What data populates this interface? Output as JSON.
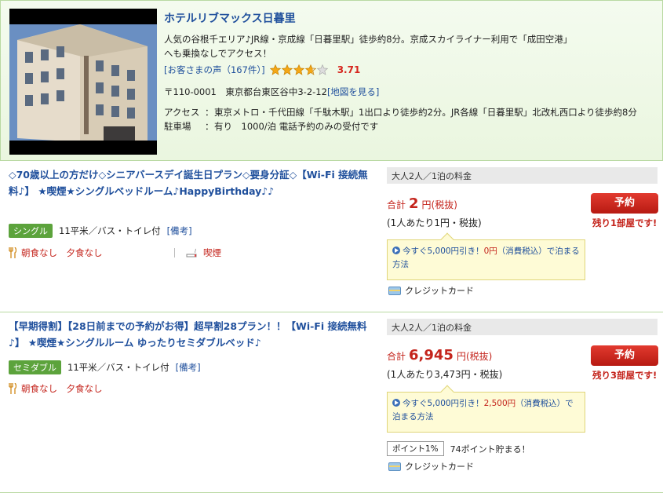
{
  "hotel": {
    "name": "ホテルリブマックス日暮里",
    "description": "人気の谷根千エリア♪JR線・京成線「日暮里駅」徒歩約8分。京成スカイライナー利用で「成田空港」へも乗換なしでアクセス！",
    "review_link": "[お客さまの声（167件）]",
    "rating_stars": 3.71,
    "rating_score": "3.71",
    "address": "〒110-0001　東京都台東区谷中3-2-12",
    "map_link": "[地図を見る]",
    "access_label": "アクセス",
    "access_text": "東京メトロ・千代田線「千駄木駅」1出口より徒歩約2分。JR各線「日暮里駅」北改札西口より徒歩約8分",
    "parking_label": "駐車場",
    "parking_text": "有り　1000/泊 電話予約のみの受付です",
    "separator": "："
  },
  "plans": [
    {
      "title": "◇70歳以上の方だけ◇シニアバースデイ誕生日プラン◇要身分証◇【Wi-Fi 接続無料♪】 ★喫煙★シングルベッドルーム♪HappyBirthday♪♪",
      "room_type": "シングル",
      "room_info": "11平米／バス・トイレ付",
      "notes_link": "[備考]",
      "meals": "朝食なし　夕食なし",
      "smoking": "喫煙",
      "price_header": "大人2人／1泊の料金",
      "total_label": "合計",
      "total_amount": "2",
      "total_unit": "円(税抜)",
      "per_person": "(1人あたり1円・税抜)",
      "reserve_label": "予約",
      "rooms_left": "残り1部屋です!",
      "promo_prefix": "今すぐ5,000円引き！",
      "promo_amount": "0円",
      "promo_suffix": "（消費税込）で泊まる方法",
      "payment": "クレジットカード"
    },
    {
      "title": "【早期得割】【28日前までの予約がお得】超早割28プラン！！【Wi-Fi 接続無料♪】 ★喫煙★シングルルーム ゆったりセミダブルベッド♪",
      "room_type": "セミダブル",
      "room_info": "11平米／バス・トイレ付",
      "notes_link": "[備考]",
      "meals": "朝食なし　夕食なし",
      "price_header": "大人2人／1泊の料金",
      "total_label": "合計",
      "total_amount": "6,945",
      "total_unit": "円(税抜)",
      "per_person": "(1人あたり3,473円・税抜)",
      "reserve_label": "予約",
      "rooms_left": "残り3部屋です!",
      "promo_prefix": "今すぐ5,000円引き！",
      "promo_amount": "2,500円",
      "promo_suffix": "（消費税込）で泊まる方法",
      "points_badge": "ポイント1%",
      "points_text": "74ポイント貯まる！",
      "payment": "クレジットカード"
    }
  ],
  "colors": {
    "link": "#1f4f9c",
    "accent_red": "#c4241c",
    "badge_green": "#5ca33c"
  }
}
